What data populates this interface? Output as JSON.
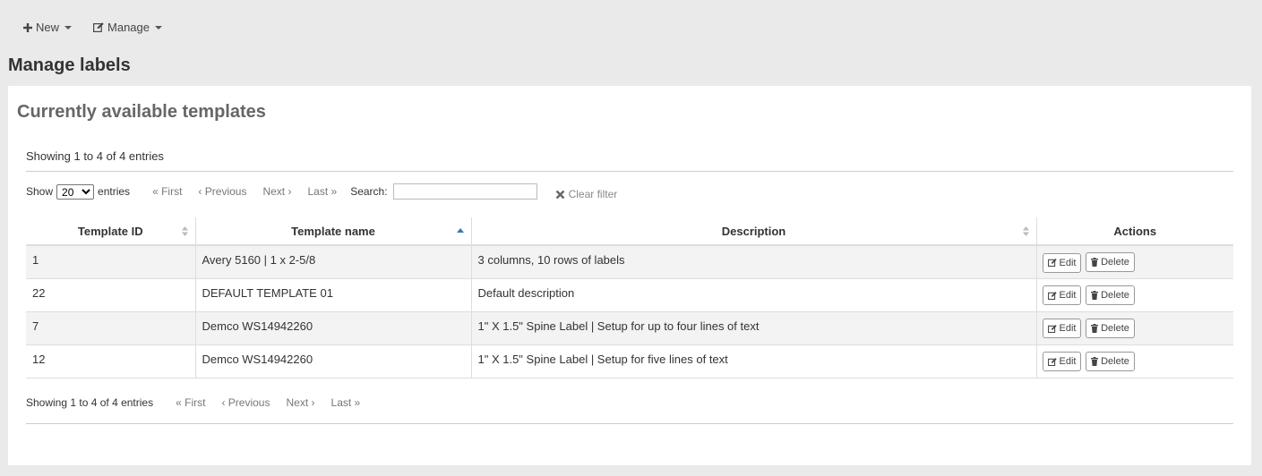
{
  "toolbar": {
    "new_label": "New",
    "manage_label": "Manage"
  },
  "page": {
    "title": "Manage labels",
    "section_title": "Currently available templates"
  },
  "info": {
    "top": "Showing 1 to 4 of 4 entries",
    "bottom": "Showing 1 to 4 of 4 entries"
  },
  "length": {
    "show_label": "Show",
    "value": "20",
    "entries_label": "entries"
  },
  "pager": {
    "first": "First",
    "previous": "Previous",
    "next": "Next",
    "last": "Last"
  },
  "search": {
    "label": "Search:",
    "value": "",
    "clear_label": "Clear filter"
  },
  "table": {
    "headers": [
      "Template ID",
      "Template name",
      "Description",
      "Actions"
    ],
    "rows": [
      [
        "1",
        "Avery 5160 | 1 x 2-5/8",
        "3 columns, 10 rows of labels"
      ],
      [
        "22",
        "DEFAULT TEMPLATE 01",
        "Default description"
      ],
      [
        "7",
        "Demco WS14942260",
        "1\" X 1.5\" Spine Label | Setup for up to four lines of text"
      ],
      [
        "12",
        "Demco WS14942260",
        "1\" X 1.5\" Spine Label | Setup for five lines of text"
      ]
    ],
    "edit_label": "Edit",
    "delete_label": "Delete"
  },
  "icons": {
    "new": "plus-icon",
    "manage": "pencil-square-icon",
    "sort": "sort-icon",
    "clear": "close-icon",
    "edit": "pencil-square-icon",
    "delete": "trash-icon"
  },
  "colors": {
    "sort_active": "#337ab7",
    "sort_inactive": "#bbbbbb"
  }
}
